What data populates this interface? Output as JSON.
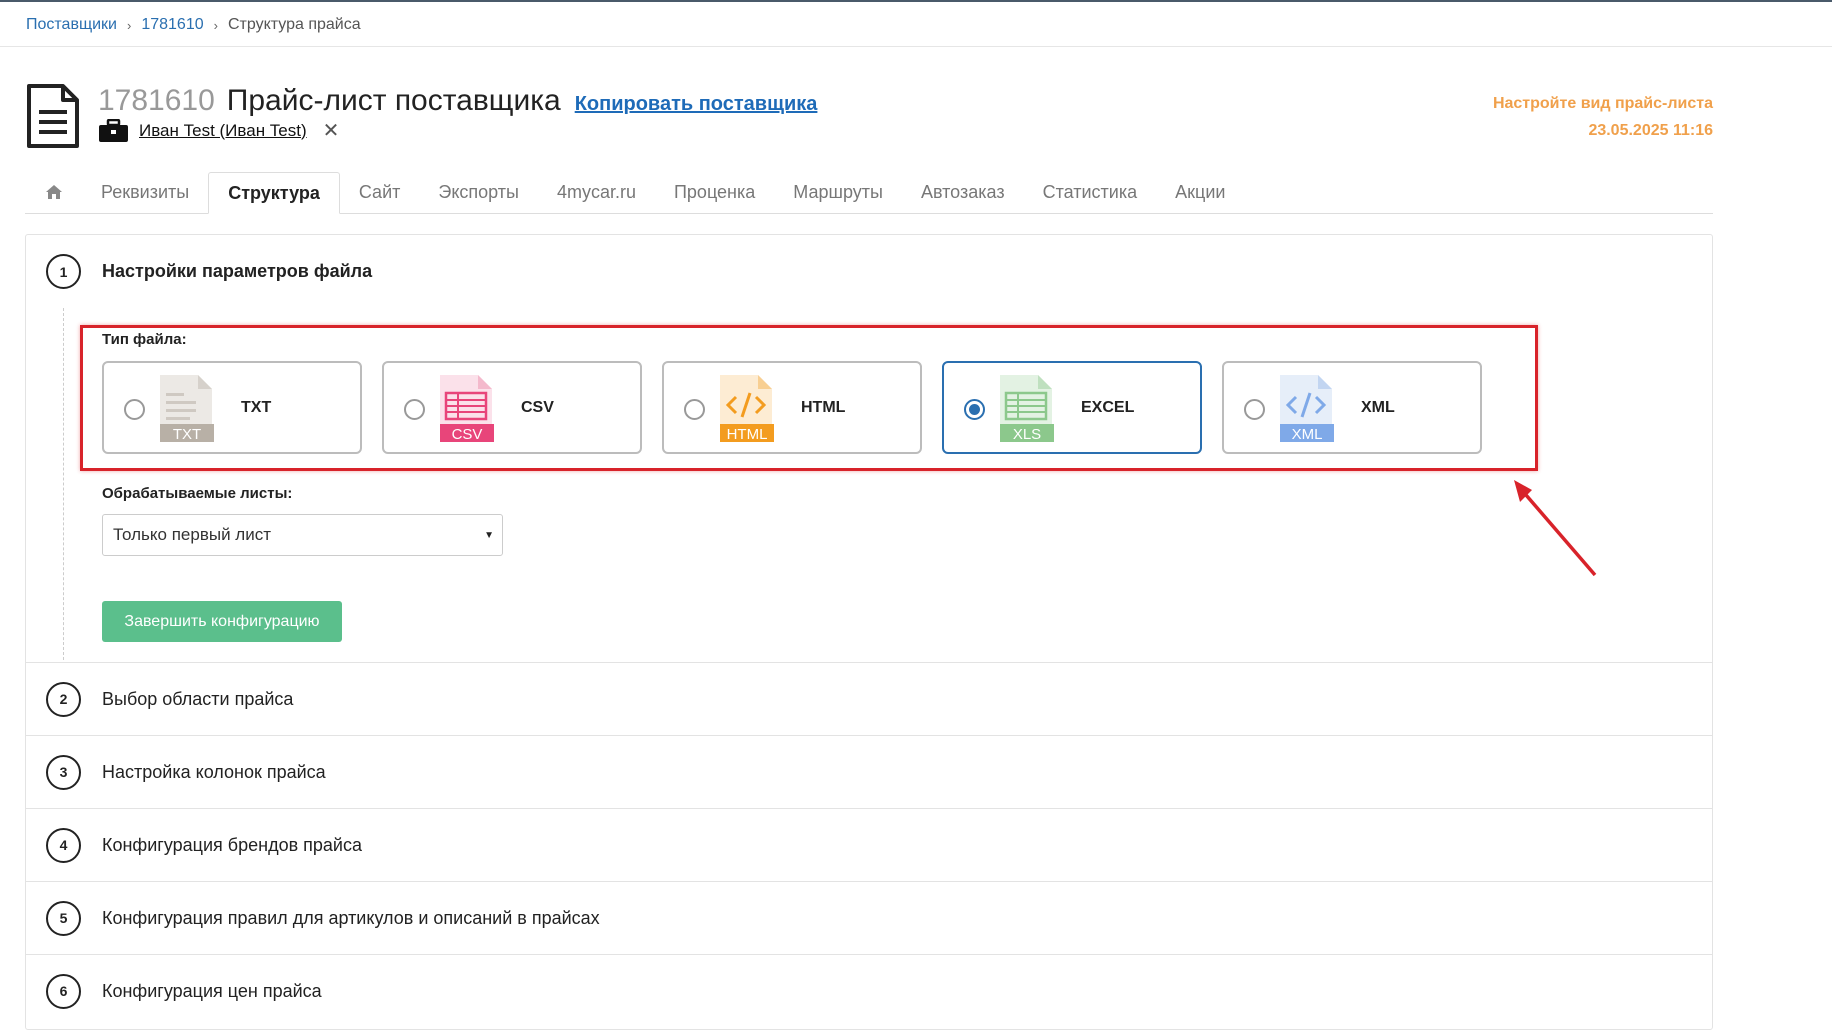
{
  "breadcrumb": {
    "items": [
      "Поставщики",
      "1781610"
    ],
    "current": "Структура прайса"
  },
  "header": {
    "id": "1781610",
    "title": "Прайс-лист поставщика",
    "copy_link": "Копировать поставщика",
    "owner": "Иван Test (Иван Test)",
    "owner_remove": "✕",
    "status_text": "Настройте вид прайс-листа",
    "status_datetime": "23.05.2025  11:16"
  },
  "tabs": [
    {
      "label": "Реквизиты"
    },
    {
      "label": "Структура"
    },
    {
      "label": "Сайт"
    },
    {
      "label": "Экспорты"
    },
    {
      "label": "4mycar.ru"
    },
    {
      "label": "Проценка"
    },
    {
      "label": "Маршруты"
    },
    {
      "label": "Автозаказ"
    },
    {
      "label": "Статистика"
    },
    {
      "label": "Акции"
    }
  ],
  "active_tab": "Структура",
  "steps": [
    {
      "num": "1",
      "title": "Настройки параметров файла"
    },
    {
      "num": "2",
      "title": "Выбор области прайса"
    },
    {
      "num": "3",
      "title": "Настройка колонок прайса"
    },
    {
      "num": "4",
      "title": "Конфигурация брендов прайса"
    },
    {
      "num": "5",
      "title": "Конфигурация правил для артикулов и описаний в прайсах"
    },
    {
      "num": "6",
      "title": "Конфигурация цен прайса"
    }
  ],
  "step1": {
    "file_type_label": "Тип файла:",
    "file_types": [
      {
        "name": "TXT",
        "badge": "TXT",
        "color": "#b8b0a6",
        "selected": false
      },
      {
        "name": "CSV",
        "badge": "CSV",
        "color": "#e8457a",
        "selected": false
      },
      {
        "name": "HTML",
        "badge": "HTML",
        "color": "#f39c1f",
        "selected": false
      },
      {
        "name": "EXCEL",
        "badge": "XLS",
        "color": "#8cc88c",
        "selected": true
      },
      {
        "name": "XML",
        "badge": "XML",
        "color": "#7fa9e8",
        "selected": false
      }
    ],
    "sheets_label": "Обрабатываемые листы:",
    "sheets_value": "Только первый лист",
    "finish_button": "Завершить конфигурацию"
  },
  "colors": {
    "accent": "#2a6fb0",
    "status": "#f0a04b",
    "highlight": "#d8232a",
    "success_button": "#5bbf8c"
  }
}
